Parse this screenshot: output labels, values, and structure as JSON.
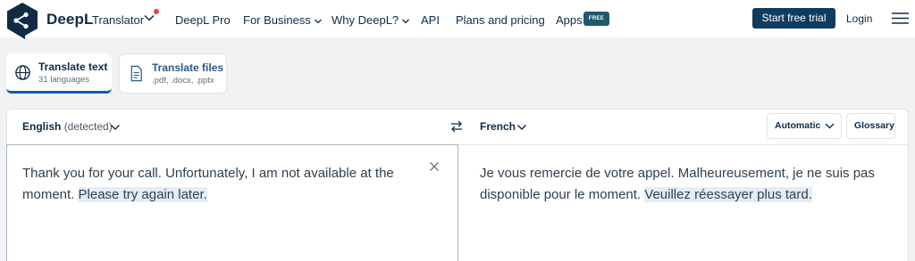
{
  "header": {
    "brand": "DeepL",
    "product": "Translator",
    "nav": [
      {
        "label": "DeepL Pro"
      },
      {
        "label": "For Business"
      },
      {
        "label": "Why DeepL?"
      },
      {
        "label": "API"
      },
      {
        "label": "Plans and pricing"
      },
      {
        "label": "Apps"
      }
    ],
    "apps_badge": "FREE",
    "cta_label": "Start free trial",
    "login_label": "Login"
  },
  "modes": {
    "text": {
      "title": "Translate text",
      "subtitle": "31 languages"
    },
    "files": {
      "title": "Translate files",
      "subtitle": ".pdf, .docx, .pptx"
    }
  },
  "translator": {
    "source_language": "English",
    "source_detected": "(detected)",
    "target_language": "French",
    "formality_label": "Automatic",
    "glossary_label": "Glossary",
    "source_text_main": "Thank you for your call. Unfortunately, I am not available at the moment. ",
    "source_text_highlight": "Please try again later.",
    "target_text_main": "Je vous remercie de votre appel. Malheureusement, je ne suis pas disponible pour le moment. ",
    "target_text_highlight": "Veuillez réessayer plus tard."
  },
  "colors": {
    "brand_navy": "#0f2b46",
    "cta_bg": "#0f3b5f",
    "active_tab_underline": "#0f5ca8",
    "free_badge_bg": "#1f5a6e",
    "notification_dot": "#e4473e",
    "highlight": "#e4edf6"
  },
  "icons": [
    "deepl-logo-icon",
    "chevron-down-icon",
    "globe-icon",
    "document-icon",
    "swap-icon",
    "close-icon",
    "hamburger-menu-icon"
  ]
}
